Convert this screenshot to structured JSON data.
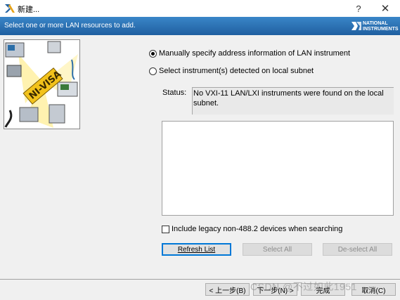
{
  "window": {
    "title": "新建...",
    "help_glyph": "?",
    "close_glyph": "✕"
  },
  "banner": {
    "instruction": "Select one or more LAN resources to add.",
    "logo_line1": "NATIONAL",
    "logo_line2": "INSTRUMENTS"
  },
  "options": {
    "manual_label": "Manually specify address information of LAN instrument",
    "manual_selected": true,
    "detect_label": "Select instrument(s) detected on local subnet",
    "detect_selected": false
  },
  "status": {
    "label": "Status:",
    "text": "No VXI-11 LAN/LXI instruments were found on the local subnet."
  },
  "legacy": {
    "label": "Include legacy non-488.2 devices when searching",
    "checked": false
  },
  "buttons": {
    "refresh": "Refresh List",
    "select_all": "Select All",
    "deselect_all": "De-select All",
    "back": "< 上一步(B)",
    "next": "下一步(N) >",
    "finish": "完成",
    "cancel": "取消(C)"
  },
  "watermark": "CSDN @不过如此1951",
  "colors": {
    "banner": "#2a72b8",
    "accent": "#0078d7"
  }
}
